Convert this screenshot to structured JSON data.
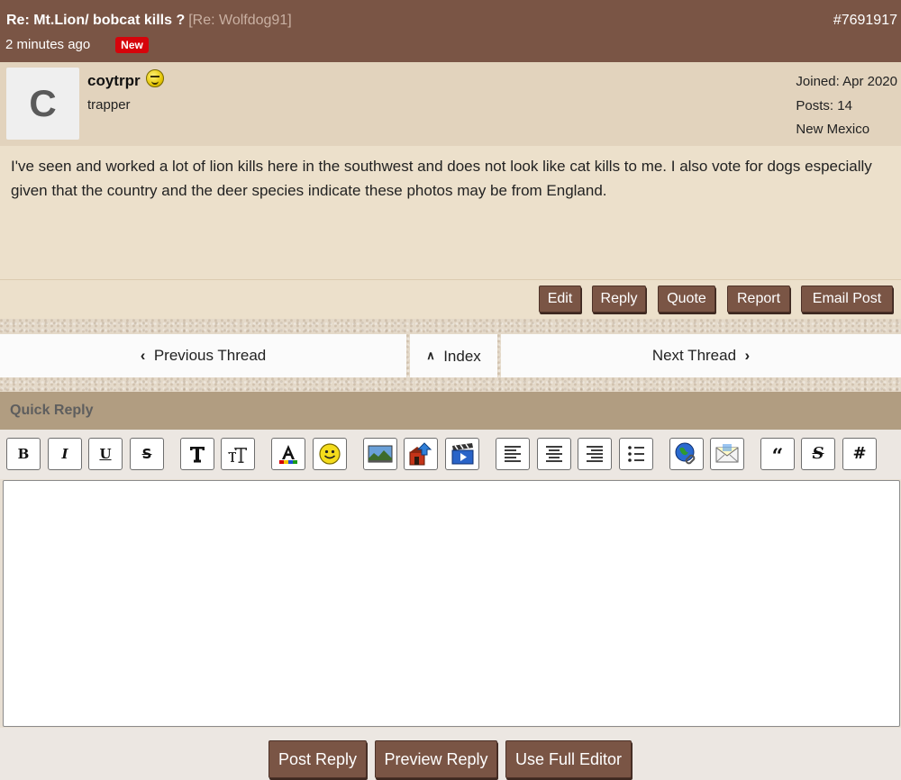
{
  "post": {
    "title": "Re: Mt.Lion/ bobcat kills ?",
    "reply_to": "[Re: Wolfdog91]",
    "number": "#7691917",
    "time": "2 minutes ago",
    "new_badge": "New",
    "author": {
      "avatar_letter": "C",
      "username": "coytrpr",
      "title": "trapper",
      "joined": "Joined: Apr 2020",
      "posts": "Posts: 14",
      "location": "New Mexico"
    },
    "body": "I've seen and worked a lot of lion kills here in the southwest and does not look like cat kills to me. I also vote for dogs especially given that the country and the deer species indicate these photos may be from England.",
    "actions": {
      "edit": "Edit",
      "reply": "Reply",
      "quote": "Quote",
      "report": "Report",
      "email": "Email Post"
    }
  },
  "nav": {
    "previous": "Previous Thread",
    "index": "Index",
    "next": "Next Thread"
  },
  "quick_reply": {
    "title": "Quick Reply",
    "toolbar": {
      "bold": "B",
      "italic": "I",
      "underline": "U",
      "strike": "S"
    },
    "buttons": {
      "post": "Post Reply",
      "preview": "Preview Reply",
      "full_editor": "Use Full Editor"
    }
  },
  "colors": {
    "header_brown": "#7a5545",
    "new_badge_red": "#d6040b",
    "quick_reply_tan": "#b19d81"
  }
}
